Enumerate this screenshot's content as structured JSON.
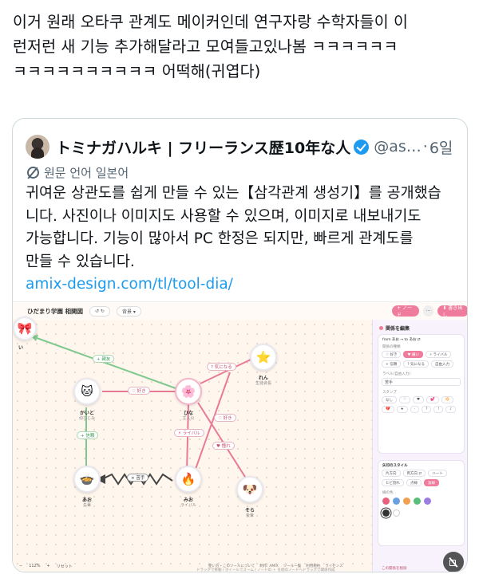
{
  "post": {
    "lines": [
      "이거 원래 오타쿠 관계도 메이커인데 연구자랑 수학자들이 이",
      "런저런 새 기능 추가해달라고 모여들고있나봄 ㅋㅋㅋㅋㅋㅋ",
      "ㅋㅋㅋㅋㅋㅋㅋㅋㅋㅋ 어떡해(귀엽다)"
    ]
  },
  "quote": {
    "author_name": "トミナガハルキ | フリーランス歴10年な人",
    "handle": "@as…",
    "separator": "·",
    "date": "6일",
    "translate_label": "원문 언어 일본어",
    "body_lines": [
      "귀여운 상관도를 쉽게 만들 수 있는【삼각관계 생성기】를 공개했습",
      "니다. 사진이나 이미지도 사용할 수 있으며, 이미지로 내보내기도",
      "가능합니다. 기능이 많아서 PC 한정은 되지만, 빠르게 관계도를",
      "만들 수 있습니다."
    ],
    "link": "amix-design.com/tl/tool-dia/"
  },
  "app": {
    "title": "ひだまり学園 相関図",
    "toolbar_pill_1": "↺ ↻",
    "toolbar_pill_2": "背景 ▾",
    "add_node_button": "+ ノード",
    "more_button": "···",
    "export_button": "⬇ 書き出し",
    "nodes": [
      {
        "emoji": "🎀",
        "name": "い",
        "sub": ""
      },
      {
        "emoji": "🐱",
        "name": "かいと",
        "sub": "幼なじみ"
      },
      {
        "emoji": "🌸",
        "name": "ひな",
        "sub": "主人公"
      },
      {
        "emoji": "⭐",
        "name": "れん",
        "sub": "生徒会長"
      },
      {
        "emoji": "🍲",
        "name": "あお",
        "sub": "先輩"
      },
      {
        "emoji": "🔥",
        "name": "みお",
        "sub": "ライバル"
      },
      {
        "emoji": "🐶",
        "name": "そら",
        "sub": "後輩"
      }
    ],
    "edges": [
      {
        "label": "+ 親友"
      },
      {
        "label": "♡ 好き"
      },
      {
        "label": "? 気になる"
      },
      {
        "label": "+ 信頼"
      },
      {
        "label": "♡ 好き"
      },
      {
        "label": "⚡ ライバル"
      },
      {
        "label": "♥ 憧れ"
      },
      {
        "label": "× 苦手"
      }
    ],
    "footer_links": [
      "使い方・このツールについて",
      "制作: AMIX",
      "ツール一覧",
      "利用規約",
      "ライセンス"
    ],
    "canvas_hint": "ドラッグで移動 / ホイールでズーム / ノードの ＋ を他のノードへドラッグで関係作成",
    "zoom": {
      "minus": "−",
      "value": "112%",
      "plus": "+",
      "reset": "リセット"
    },
    "panel": {
      "title": "関係を編集",
      "from_to": "from あお → to あお ⇄",
      "type_label": "関係の種類",
      "types": [
        "♡ 好き",
        "♥ 嫌い",
        "⚡ ライバル",
        "+ 信頼",
        "? 気になる",
        "自由入力"
      ],
      "label_label": "ラベル(自由入力)",
      "label_value": "苦手",
      "stamp_label": "スタンプ",
      "stamps": [
        "なし",
        "♡",
        "♥",
        "💕",
        "🔆",
        "💔",
        "★",
        "·",
        "?",
        "!",
        "♪",
        "🌟",
        "💢"
      ],
      "line_style_title": "矢印のスタイル",
      "line_styles": [
        "片方向",
        "両方向 ⇄",
        "ハート",
        "ヒビ割れ",
        "点線",
        "波線"
      ],
      "color_label": "線の色",
      "colors": [
        "#e8607e",
        "#6aa0e0",
        "#f0a050",
        "#5bbd7a",
        "#9b7ee0",
        "#f0c040",
        "#333333",
        "#ffffff"
      ],
      "delete_label": "この関係を削除"
    }
  }
}
